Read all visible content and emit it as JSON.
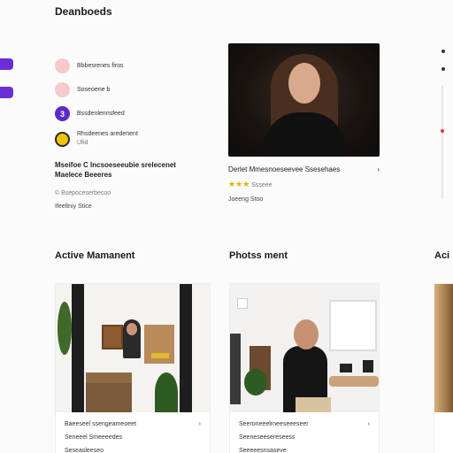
{
  "app": {
    "title": "Deanboeds"
  },
  "feed": {
    "items": [
      {
        "text": "Bbbesrenes firos",
        "avatar_color": "#f6caca",
        "avatar_text": ""
      },
      {
        "text": "Soseoene b",
        "avatar_color": "#f6caca",
        "avatar_text": ""
      },
      {
        "text": "Bssdenlennsfeed",
        "avatar_color": "#5a2bc8",
        "avatar_text": "3"
      },
      {
        "text": "Rhsdeenes aredenent",
        "text2": "Ufid",
        "avatar_color": "#f1c400",
        "avatar_text": ""
      }
    ],
    "post_title": "Mseifoe C Incsoeseeubie srelecenet",
    "post_title2": "Maelece Beeeres",
    "post_meta": "© Bsepoceserbecoo",
    "post_tag": "Ifeeltniy Stice"
  },
  "feature": {
    "caption": "Derlet Mmesnoeseevee Ssesehaes",
    "caption_icon": "›",
    "rating_text": "Ssseee",
    "tag": "Joeeng Stoo"
  },
  "sections": {
    "active_title": "Active Mamanent",
    "photos_title": "Photss ment",
    "partial_title": "Aci"
  },
  "cards": [
    {
      "line1": "Baeeseel ssengeameoeet",
      "line1_icon": "›",
      "line2": "Seneeel Smeeeedes",
      "line3": "Seseasleeseo"
    },
    {
      "line1": "Seeroneeelrneeseeeseer",
      "line1_icon": "›",
      "line2": "Seeneseesereseess",
      "line3": "Seeeeesnsaseve"
    },
    {
      "line1": "",
      "line2": "",
      "line3": ""
    }
  ],
  "colors": {
    "accent_purple": "#6a2fd6",
    "star_yellow": "#e0b000",
    "scroll_red": "#e03b3b"
  }
}
